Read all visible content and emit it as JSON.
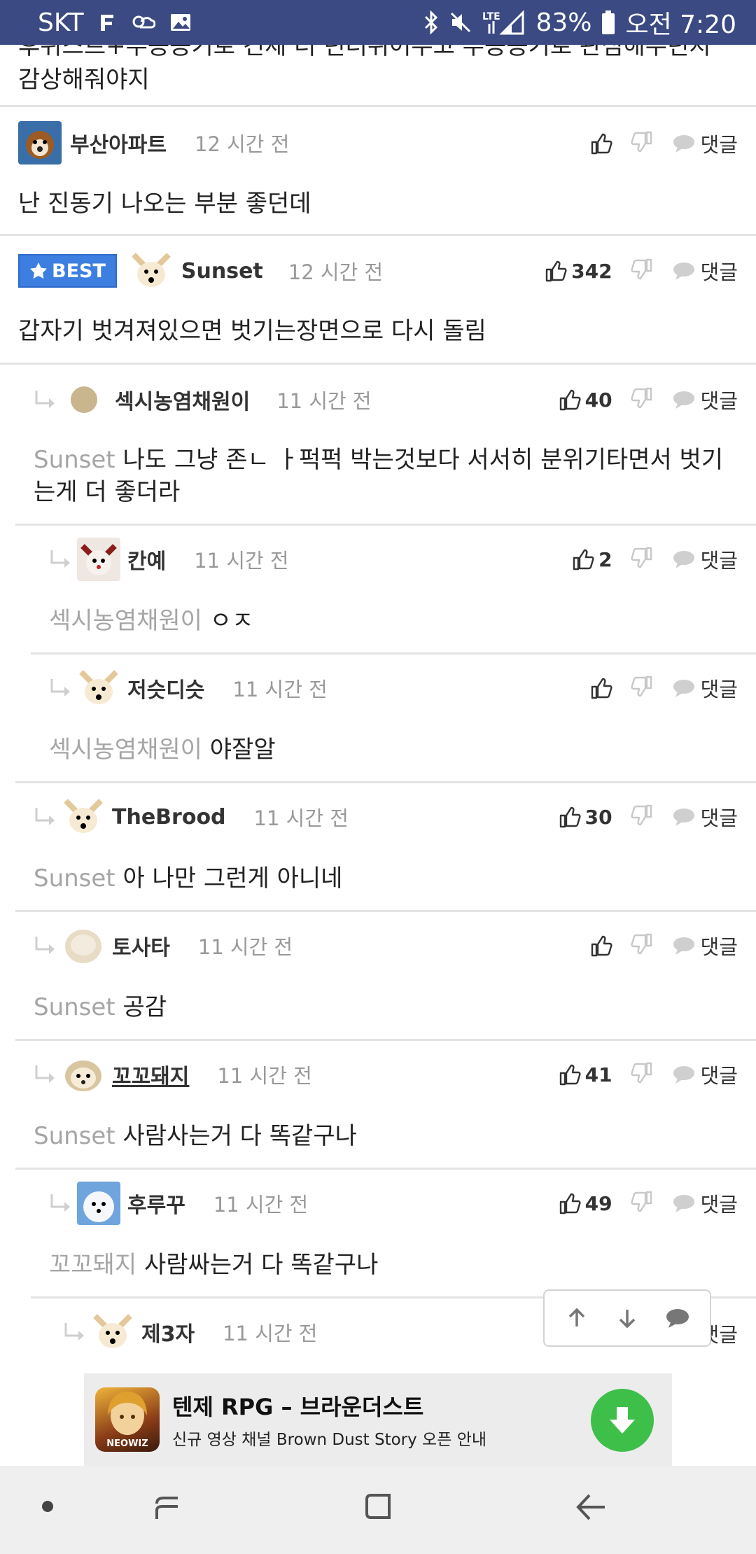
{
  "status_bar": {
    "carrier": "SKT",
    "battery": "83%",
    "time": "오전 7:20",
    "lte": "LTE"
  },
  "partial_comment": {
    "line1": "후위스트+부농농기로 건제 더 던더뷔어우고 부농농기로 관심해주던지",
    "line2": "감상해줘야지"
  },
  "comments": [
    {
      "author": "부산아파트",
      "time": "12 시간 전",
      "likes": "",
      "reply_label": "댓글",
      "mention": "",
      "body": "난 진동기 나오는 부분 좋던데"
    },
    {
      "best_label": "BEST",
      "author": "Sunset",
      "time": "12 시간 전",
      "likes": "342",
      "reply_label": "댓글",
      "mention": "",
      "body": "갑자기 벗겨져있으면 벗기는장면으로 다시 돌림"
    },
    {
      "author": "섹시농염채원이",
      "time": "11 시간 전",
      "likes": "40",
      "reply_label": "댓글",
      "mention": "Sunset",
      "body": "나도 그냥 존ㄴ ㅏ퍽퍽 박는것보다 서서히 분위기타면서 벗기",
      "body2": "는게 더 좋더라"
    },
    {
      "author": "칸예",
      "time": "11 시간 전",
      "likes": "2",
      "reply_label": "댓글",
      "mention": "섹시농염채원이",
      "body": "ㅇㅈ"
    },
    {
      "author": "저슷디슷",
      "time": "11 시간 전",
      "likes": "",
      "reply_label": "댓글",
      "mention": "섹시농염채원이",
      "body": "야잘알"
    },
    {
      "author": "TheBrood",
      "time": "11 시간 전",
      "likes": "30",
      "reply_label": "댓글",
      "mention": "Sunset",
      "body": "아 나만 그런게 아니네"
    },
    {
      "author": "토사타",
      "time": "11 시간 전",
      "likes": "",
      "reply_label": "댓글",
      "mention": "Sunset",
      "body": "공감"
    },
    {
      "author": "꼬꼬돼지",
      "time": "11 시간 전",
      "likes": "41",
      "reply_label": "댓글",
      "mention": "Sunset",
      "body": "사람사는거 다 똑같구나"
    },
    {
      "author": "후루꾸",
      "time": "11 시간 전",
      "likes": "49",
      "reply_label": "댓글",
      "mention": "꼬꼬돼지",
      "body": "사람싸는거 다 똑같구나"
    },
    {
      "author": "제3자",
      "time": "11 시간 전",
      "likes": "",
      "reply_label": "댓글",
      "mention": "",
      "body": ""
    }
  ],
  "ad": {
    "title": "텐제 RPG – 브라운더스트",
    "subtitle": "신규 영상 채널 Brown Dust Story 오픈 안내",
    "icon_text": "NEOWIZ"
  },
  "colors": {
    "status_bar": "#3b4a83",
    "best_badge": "#3d7fe0",
    "mention": "#a5a5a5",
    "download_button": "#3ebf4a"
  }
}
